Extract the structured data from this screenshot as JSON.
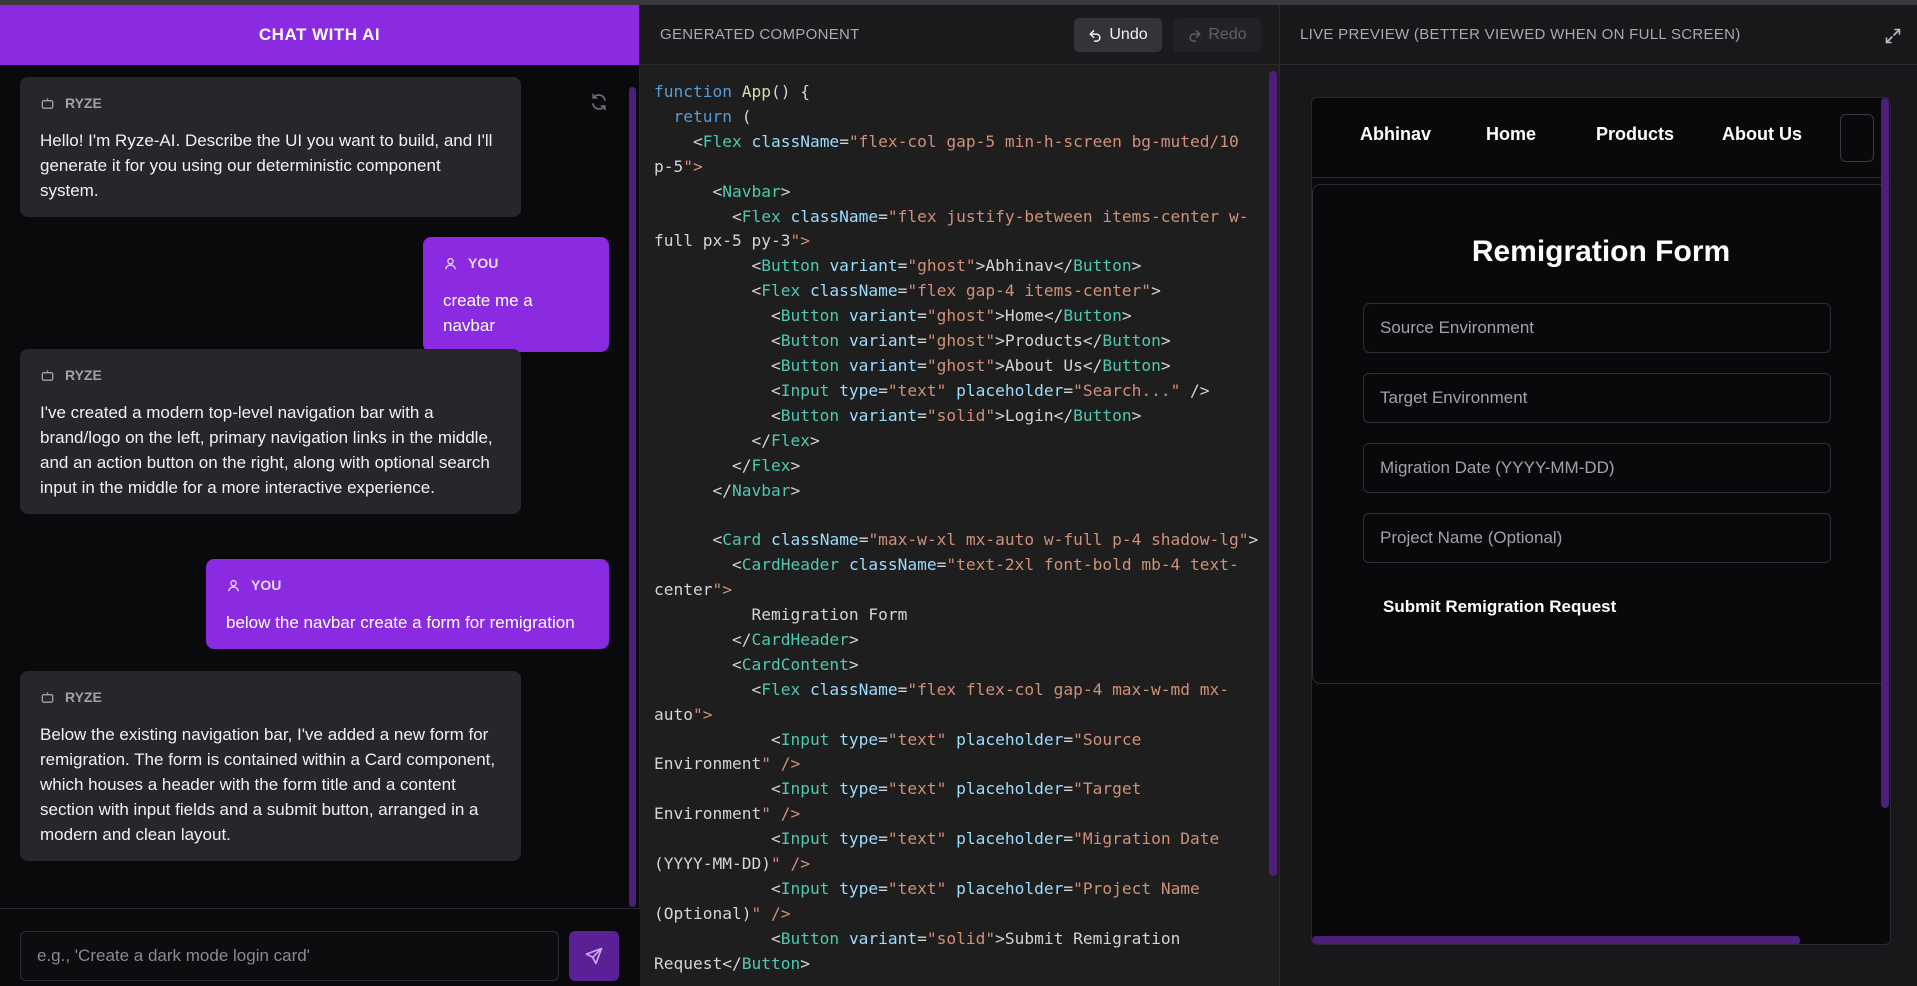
{
  "chat": {
    "header": "CHAT WITH AI",
    "messages": [
      {
        "role": "RYZE",
        "text": "Hello! I'm Ryze-AI. Describe the UI you want to build, and I'll generate it for you using our deterministic component system."
      },
      {
        "role": "YOU",
        "text": "create me a navbar"
      },
      {
        "role": "RYZE",
        "text": "I've created a modern top-level navigation bar with a brand/logo on the left, primary navigation links in the middle, and an action button on the right, along with optional search input in the middle for a more interactive experience."
      },
      {
        "role": "YOU",
        "text": "below the navbar create a form for remigration"
      },
      {
        "role": "RYZE",
        "text": "Below the existing navigation bar, I've added a new form for remigration. The form is contained within a Card component, which houses a header with the form title and a content section with input fields and a submit button, arranged in a modern and clean layout."
      }
    ],
    "input_placeholder": "e.g., 'Create a dark mode login card'",
    "icons": {
      "refresh": "refresh-icon",
      "send": "send-icon",
      "bot": "bot-icon",
      "user": "user-icon"
    }
  },
  "code": {
    "title": "GENERATED COMPONENT",
    "undo_label": "Undo",
    "redo_label": "Redo",
    "lines": [
      "function App() {",
      "  return (",
      "    <Flex className=\"flex-col gap-5 min-h-screen bg-muted/10",
      "p-5\">",
      "      <Navbar>",
      "        <Flex className=\"flex justify-between items-center w-",
      "full px-5 py-3\">",
      "          <Button variant=\"ghost\">Abhinav</Button>",
      "          <Flex className=\"flex gap-4 items-center\">",
      "            <Button variant=\"ghost\">Home</Button>",
      "            <Button variant=\"ghost\">Products</Button>",
      "            <Button variant=\"ghost\">About Us</Button>",
      "            <Input type=\"text\" placeholder=\"Search...\" />",
      "            <Button variant=\"solid\">Login</Button>",
      "          </Flex>",
      "        </Flex>",
      "      </Navbar>",
      "",
      "      <Card className=\"max-w-xl mx-auto w-full p-4 shadow-lg\">",
      "        <CardHeader className=\"text-2xl font-bold mb-4 text-",
      "center\">",
      "          Remigration Form",
      "        </CardHeader>",
      "        <CardContent>",
      "          <Flex className=\"flex flex-col gap-4 max-w-md mx-",
      "auto\">",
      "            <Input type=\"text\" placeholder=\"Source",
      "Environment\" />",
      "            <Input type=\"text\" placeholder=\"Target",
      "Environment\" />",
      "            <Input type=\"text\" placeholder=\"Migration Date",
      "(YYYY-MM-DD)\" />",
      "            <Input type=\"text\" placeholder=\"Project Name",
      "(Optional)\" />",
      "            <Button variant=\"solid\">Submit Remigration",
      "Request</Button>"
    ]
  },
  "preview": {
    "title": "LIVE PREVIEW (BETTER VIEWED WHEN ON FULL SCREEN)",
    "nav": {
      "brand": "Abhinav",
      "links": [
        "Home",
        "Products",
        "About Us"
      ]
    },
    "form": {
      "title": "Remigration Form",
      "fields": [
        "Source Environment",
        "Target Environment",
        "Migration Date (YYYY-MM-DD)",
        "Project Name (Optional)"
      ],
      "submit": "Submit Remigration Request"
    },
    "icons": {
      "expand": "expand-icon"
    }
  },
  "colors": {
    "accent": "#8a2be2",
    "panel": "#27272b",
    "scrollbar": "#4b1f7a"
  }
}
